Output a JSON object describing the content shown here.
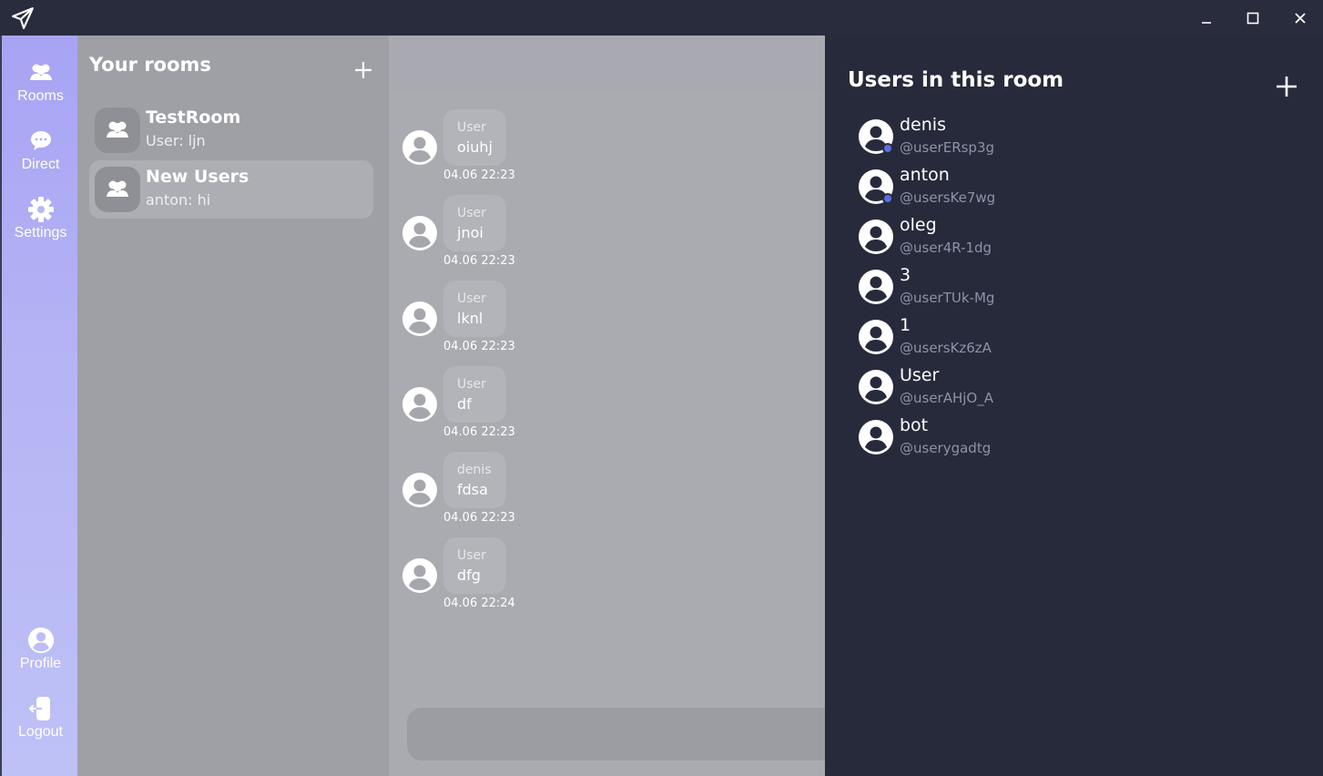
{
  "window": {
    "minimize_icon": "minimize-icon",
    "maximize_icon": "maximize-icon",
    "close_icon": "close-icon",
    "logo_icon": "paper-plane-icon"
  },
  "nav": {
    "items": [
      {
        "label": "Rooms",
        "icon": "users-icon"
      },
      {
        "label": "Direct",
        "icon": "chat-bubble-icon"
      },
      {
        "label": "Settings",
        "icon": "gear-icon"
      },
      {
        "label": "Profile",
        "icon": "user-circle-icon"
      },
      {
        "label": "Logout",
        "icon": "logout-icon"
      }
    ]
  },
  "rooms": {
    "title": "Your rooms",
    "add_icon": "plus-icon",
    "list": [
      {
        "name": "TestRoom",
        "last": "User: ljn",
        "active": false
      },
      {
        "name": "New Users",
        "last": "anton: hi",
        "active": true
      }
    ]
  },
  "chat": {
    "messages": [
      {
        "user": "User",
        "text": "oiuhj",
        "time": "04.06 22:23"
      },
      {
        "user": "User",
        "text": "jnoi",
        "time": "04.06 22:23"
      },
      {
        "user": "User",
        "text": "lknl",
        "time": "04.06 22:23"
      },
      {
        "user": "User",
        "text": "df",
        "time": "04.06 22:23"
      },
      {
        "user": "denis",
        "text": "fdsa",
        "time": "04.06 22:23"
      },
      {
        "user": "User",
        "text": "dfg",
        "time": "04.06 22:24"
      }
    ],
    "composer_placeholder": ""
  },
  "users": {
    "title": "Users in this room",
    "add_icon": "plus-icon",
    "list": [
      {
        "name": "denis",
        "handle": "@userERsp3g",
        "online": true
      },
      {
        "name": "anton",
        "handle": "@usersKe7wg",
        "online": true
      },
      {
        "name": "oleg",
        "handle": "@user4R-1dg",
        "online": false
      },
      {
        "name": "3",
        "handle": "@userTUk-Mg",
        "online": false
      },
      {
        "name": "1",
        "handle": "@usersKz6zA",
        "online": false
      },
      {
        "name": "User",
        "handle": "@userAHjO_A",
        "online": false
      },
      {
        "name": "bot",
        "handle": "@userygadtg",
        "online": false
      }
    ],
    "status_color": "#5b6ee1"
  }
}
